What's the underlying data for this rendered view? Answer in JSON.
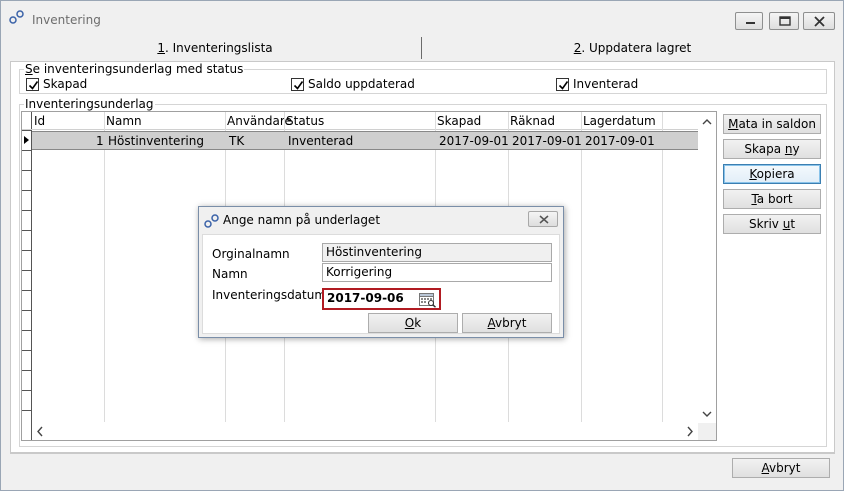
{
  "window": {
    "title": "Inventering"
  },
  "tabs": [
    {
      "label": "1. Inventeringslista",
      "key": "1",
      "rest": ". Inventeringslista"
    },
    {
      "label": "2. Uppdatera lagret",
      "key": "2",
      "rest": ". Uppdatera lagret"
    }
  ],
  "status_filter": {
    "legend_key": "S",
    "legend_rest": "e inventeringsunderlag med status",
    "options": [
      {
        "label": "Skapad",
        "checked": true
      },
      {
        "label": "Saldo uppdaterad",
        "checked": true
      },
      {
        "label": "Inventerad",
        "checked": true
      }
    ]
  },
  "list": {
    "legend": "Inventeringsunderlag",
    "columns": [
      "Id",
      "Namn",
      "Användare",
      "Status",
      "Skapad",
      "Räknad",
      "Lagerdatum"
    ],
    "rows": [
      {
        "id": "1",
        "name": "Höstinventering",
        "user": "TK",
        "status": "Inventerad",
        "created": "2017-09-01",
        "counted": "2017-09-01",
        "stock_date": "2017-09-01"
      }
    ]
  },
  "side_buttons": [
    {
      "pre": "",
      "key": "M",
      "post": "ata in saldon"
    },
    {
      "pre": "Skapa ",
      "key": "n",
      "post": "y"
    },
    {
      "pre": "",
      "key": "K",
      "post": "opiera"
    },
    {
      "pre": "",
      "key": "T",
      "post": "a bort"
    },
    {
      "pre": "Skriv ",
      "key": "u",
      "post": "t"
    }
  ],
  "footer": {
    "cancel_key": "A",
    "cancel_rest": "vbryt"
  },
  "dialog": {
    "title": "Ange namn på underlaget",
    "original_label": "Orginalnamn",
    "original_value": "Höstinventering",
    "name_label": "Namn",
    "name_value": "Korrigering",
    "date_label": "Inventeringsdatum",
    "date_value": "2017-09-06",
    "ok_key": "O",
    "ok_rest": "k",
    "cancel_key": "A",
    "cancel_rest": "vbryt"
  }
}
